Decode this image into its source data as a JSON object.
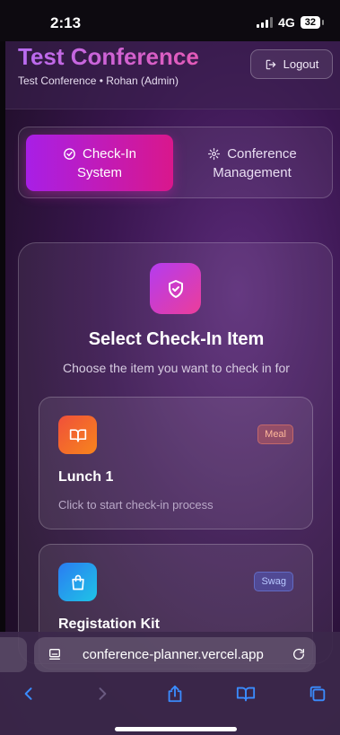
{
  "status_bar": {
    "time": "2:13",
    "network": "4G",
    "battery": "32"
  },
  "header": {
    "title": "Test Conference",
    "subtitle": "Test Conference • Rohan (Admin)",
    "logout_label": "Logout"
  },
  "tabs": [
    {
      "line1": "Check-In",
      "line2": "System",
      "icon": "check-circle-icon",
      "active": true
    },
    {
      "line1": "Conference",
      "line2": "Management",
      "icon": "gear-icon",
      "active": false
    }
  ],
  "card": {
    "icon": "shield-check-icon",
    "title": "Select Check-In Item",
    "subtitle": "Choose the item you want to check in for",
    "items": [
      {
        "name": "Lunch 1",
        "tag": "Meal",
        "description": "Click to start check-in process",
        "icon": "book-icon"
      },
      {
        "name": "Registation Kit",
        "tag": "Swag",
        "description": "",
        "icon": "shopping-bag-icon"
      }
    ]
  },
  "browser": {
    "url": "conference-planner.vercel.app"
  },
  "colors": {
    "accent_start": "#a81fe6",
    "accent_end": "#d9178c",
    "ios_blue": "#3a8cff"
  }
}
